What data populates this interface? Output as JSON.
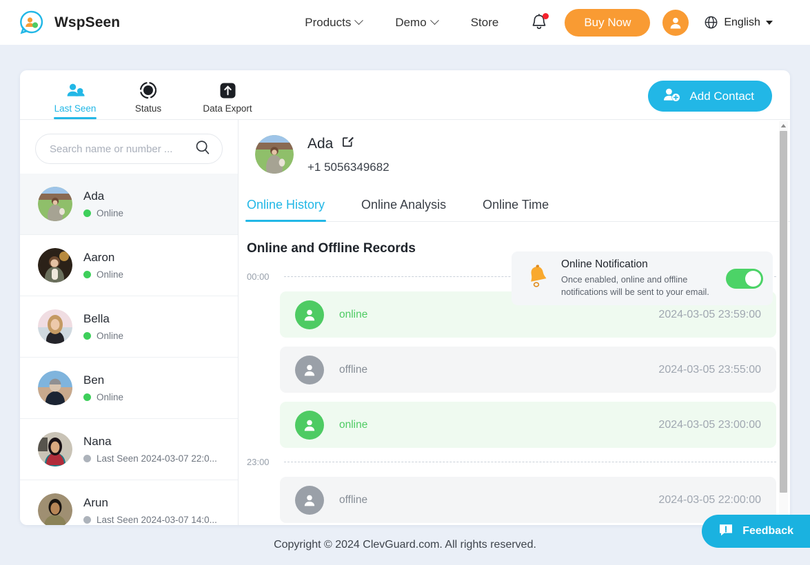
{
  "nav": {
    "brand": "WspSeen",
    "brand_logo_icon": "wspseen-logo-icon",
    "links": [
      {
        "label": "Products",
        "has_caret": true
      },
      {
        "label": "Demo",
        "has_caret": true
      },
      {
        "label": "Store",
        "has_caret": false
      }
    ],
    "bell_icon": "notification-bell-icon",
    "buy_now": "Buy Now",
    "account_icon": "user-avatar-icon",
    "globe_icon": "globe-icon",
    "language": "English"
  },
  "card": {
    "main_tabs": [
      {
        "label": "Last Seen",
        "icon": "people-icon",
        "active": true
      },
      {
        "label": "Status",
        "icon": "status-ring-icon",
        "active": false
      },
      {
        "label": "Data Export",
        "icon": "upload-box-icon",
        "active": false
      }
    ],
    "add_contact": "Add Contact",
    "add_contact_icon": "add-user-icon"
  },
  "sidebar": {
    "search_placeholder": "Search name or number ...",
    "search_value": "",
    "search_icon": "search-icon",
    "contacts": [
      {
        "name": "Ada",
        "status": "Online",
        "state": "online",
        "selected": true
      },
      {
        "name": "Aaron",
        "status": "Online",
        "state": "online",
        "selected": false
      },
      {
        "name": "Bella",
        "status": "Online",
        "state": "online",
        "selected": false
      },
      {
        "name": "Ben",
        "status": "Online",
        "state": "online",
        "selected": false
      },
      {
        "name": "Nana",
        "status": "Last Seen 2024-03-07 22:0...",
        "state": "offline",
        "selected": false
      },
      {
        "name": "Arun",
        "status": "Last Seen 2024-03-07 14:0...",
        "state": "offline",
        "selected": false
      }
    ]
  },
  "detail": {
    "name": "Ada",
    "edit_icon": "edit-pencil-icon",
    "phone": "+1 5056349682",
    "notification": {
      "bell_icon": "orange-bell-icon",
      "title": "Online Notification",
      "subtitle": "Once enabled, online and offline notifications will be sent to your email.",
      "toggle_on": true
    },
    "sub_tabs": [
      {
        "label": "Online History",
        "active": true
      },
      {
        "label": "Online Analysis",
        "active": false
      },
      {
        "label": "Online Time",
        "active": false
      }
    ],
    "section_title": "Online and Offline Records",
    "timeline": [
      {
        "kind": "mark",
        "time": "00:00"
      },
      {
        "kind": "record",
        "state": "online",
        "label": "online",
        "time": "2024-03-05 23:59:00"
      },
      {
        "kind": "record",
        "state": "offline",
        "label": "offline",
        "time": "2024-03-05 23:55:00"
      },
      {
        "kind": "record",
        "state": "online",
        "label": "online",
        "time": "2024-03-05 23:00:00"
      },
      {
        "kind": "mark",
        "time": "23:00"
      },
      {
        "kind": "record",
        "state": "offline",
        "label": "offline",
        "time": "2024-03-05 22:00:00"
      }
    ]
  },
  "footer": {
    "copyright": "Copyright © 2024 ClevGuard.com. All rights reserved.",
    "feedback": "Feedback",
    "feedback_icon": "exclamation-bubble-icon"
  },
  "colors": {
    "accent": "#22b7e6",
    "orange": "#f99b33",
    "online_green": "#4ecb63",
    "offline_gray": "#9aa0a8",
    "page_bg": "#eaeff7"
  }
}
